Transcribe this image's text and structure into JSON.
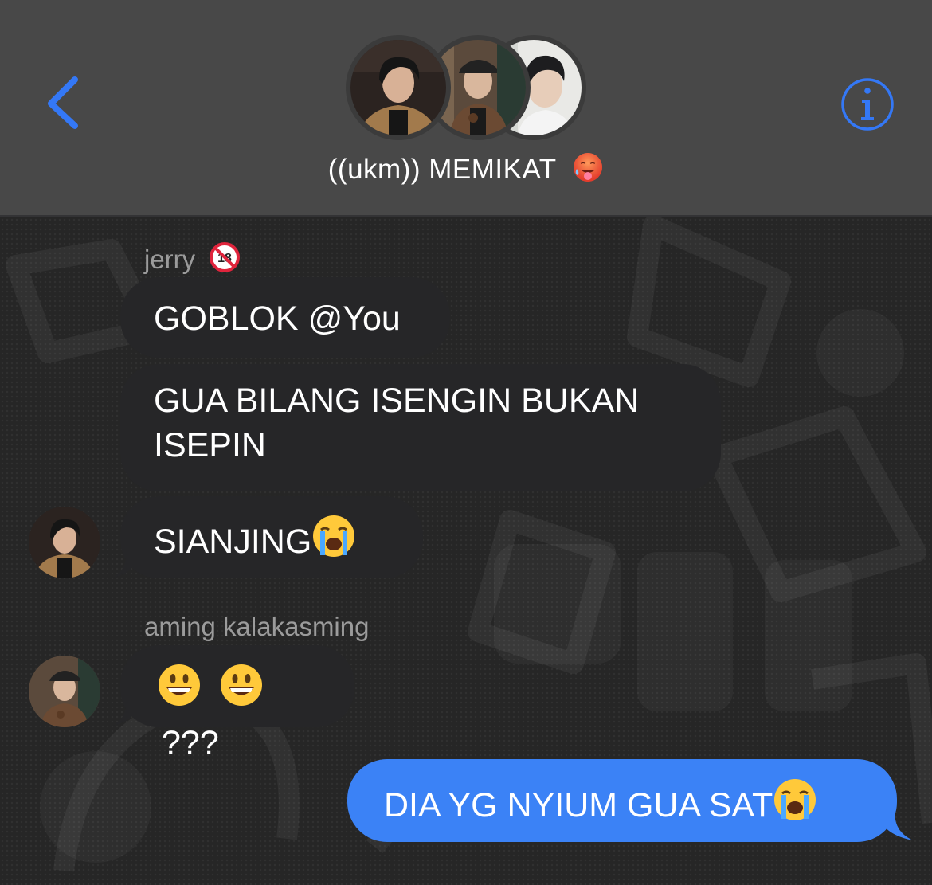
{
  "header": {
    "title": "((ukm)) MEMIKAT",
    "title_emoji_icon": "hot-face-emoji",
    "back_icon": "chevron-left-icon",
    "info_icon": "info-icon",
    "accent_color": "#3478F6"
  },
  "messages": [
    {
      "sender": "jerry",
      "sender_badge_icon": "no-one-under-18-emoji",
      "text": "GOBLOK @You",
      "direction": "incoming"
    },
    {
      "text": "GUA BILANG ISENGIN BUKAN ISEPIN",
      "direction": "incoming"
    },
    {
      "text": "SIANJING ",
      "emoji_icon": "loudly-crying-face-emoji",
      "direction": "incoming"
    },
    {
      "sender": "aming kalakasming",
      "text": "???",
      "emoji_icons": [
        "grinning-face-emoji",
        "grinning-face-emoji"
      ],
      "direction": "incoming"
    },
    {
      "text": "DIA YG NYIUM GUA SAT",
      "emoji_icon": "loudly-crying-face-emoji",
      "direction": "outgoing"
    }
  ],
  "colors": {
    "header_bg": "#484848",
    "incoming_bubble": "#262628",
    "outgoing_bubble": "#3B82F6",
    "sender_name": "#9B9B9B"
  }
}
